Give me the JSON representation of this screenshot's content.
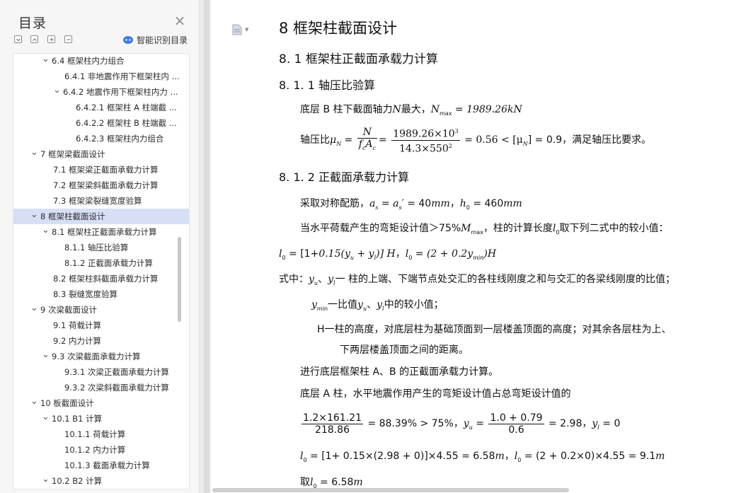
{
  "sidebar": {
    "title": "目录",
    "close_icon": "close-icon",
    "tool_buttons": [
      "collapse-all-icon",
      "expand-one-icon",
      "add-icon",
      "remove-icon"
    ],
    "smart_toc_label": "智能识别目录",
    "items": [
      {
        "label": "6.4  框架柱内力组合",
        "level": 1,
        "expanded": true
      },
      {
        "label": "6.4.1  非地震作用下框架柱内 ...",
        "level": 2
      },
      {
        "label": "6.4.2  地震作用下框架柱内力 ...",
        "level": 2,
        "expanded": true
      },
      {
        "label": "6.4.2.1  框架柱 A 柱端截 ...",
        "level": 3
      },
      {
        "label": "6.4.2.2  框架柱 B 柱端截 ...",
        "level": 3
      },
      {
        "label": "6.4.2.3  框架柱内力组合",
        "level": 3
      },
      {
        "label": "7  框架梁截面设计",
        "level": 0,
        "expanded": true
      },
      {
        "label": "7.1  框架梁正截面承载力计算",
        "level": 1
      },
      {
        "label": "7.2  框架梁斜截面承载力计算",
        "level": 1
      },
      {
        "label": "7.3  框架梁裂缝宽度验算",
        "level": 1
      },
      {
        "label": "8  框架柱截面设计",
        "level": 0,
        "expanded": true,
        "selected": true
      },
      {
        "label": "8.1  框架柱正截面承载力计算",
        "level": 1,
        "expanded": true
      },
      {
        "label": "8.1.1  轴压比验算",
        "level": 2
      },
      {
        "label": "8.1.2  正截面承载力计算",
        "level": 2
      },
      {
        "label": "8.2  框架柱斜截面承载力计算",
        "level": 1
      },
      {
        "label": "8.3  裂缝宽度验算",
        "level": 1
      },
      {
        "label": "9  次梁截面设计",
        "level": 0,
        "expanded": true
      },
      {
        "label": "9.1  荷载计算",
        "level": 1
      },
      {
        "label": "9.2  内力计算",
        "level": 1
      },
      {
        "label": "9.3  次梁截面承载力计算",
        "level": 1,
        "expanded": true
      },
      {
        "label": "9.3.1  次梁正截面承载力计算",
        "level": 2
      },
      {
        "label": "9.3.2  次梁斜截面承载力计算",
        "level": 2
      },
      {
        "label": "10  板截面设计",
        "level": 0,
        "expanded": true
      },
      {
        "label": "10.1  B1 计算",
        "level": 1,
        "expanded": true
      },
      {
        "label": "10.1.1  荷载计算",
        "level": 2
      },
      {
        "label": "10.1.2  内力计算",
        "level": 2
      },
      {
        "label": "10.1.3  截面承载力计算",
        "level": 2
      },
      {
        "label": "10.2  B2 计算",
        "level": 1,
        "expanded": true
      }
    ]
  },
  "doc": {
    "h1": "8  框架柱截面设计",
    "h2": "8. 1  框架柱正截面承载力计算",
    "h3a": "8. 1. 1  轴压比验算",
    "p1_pre": "底层 B 柱下截面轴力",
    "p1_N": "N",
    "p1_mid": "最大，",
    "p1_Nmax": "N",
    "p1_max_sub": "max",
    "p1_val": " = 1989.26",
    "p1_unit": "kN",
    "p2_pre": "轴压比",
    "p2_mu": "μ",
    "p2_N_sub": "N",
    "p2_eq": " = ",
    "p2_frac1_num": "N",
    "p2_frac1_den": "f",
    "p2_frac1_den_sub": "c",
    "p2_frac1_den2": "A",
    "p2_frac1_den2_sub": "c",
    "p2_frac2_num": "1989.26×10",
    "p2_frac2_num_sup": "3",
    "p2_frac2_den": "14.3×550",
    "p2_frac2_den_sup": "2",
    "p2_tail": " = 0.56 < [μ",
    "p2_tail_sub": "N",
    "p2_tail2": "] = 0.9",
    "p2_comment": "，满足轴压比要求。",
    "h3b": "8. 1. 2  正截面承载力计算",
    "p3": "采取对称配筋，",
    "p3_m": "a",
    "p3_s1": "s",
    "p3_eq1": " = a",
    "p3_s2": "s",
    "p3_prime": "′",
    "p3_val1": " = 40",
    "p3_unit1": "mm",
    "p3_comma": "，",
    "p3_h": "h",
    "p3_h_sub": "0",
    "p3_val2": " = 460",
    "p3_unit2": "mm",
    "p4_pre": "当水平荷载产生的弯矩设计值＞75%",
    "p4_M": "M",
    "p4_M_sub": "max",
    "p4_mid": "，柱的计算长度",
    "p4_l": "l",
    "p4_l_sub": "0",
    "p4_post": "取下列二式中的较小值：",
    "f1_l": "l",
    "f1_sub": "0",
    "f1_eq": " = ",
    "f1_overlap": "[1+",
    "f1_body": "0.15(y",
    "f1_yu_sub": "u",
    "f1_plus": " + y",
    "f1_yl_sub": "l",
    "f1_close": ")] H",
    "f1_sep": "，",
    "f2_l": "l",
    "f2_sub": "0",
    "f2_body": " = (2 + 0.2y",
    "f2_min": "min",
    "f2_close": ")H",
    "p5_pre": "式中：",
    "p5_yu": "y",
    "p5_yu_sub": "u",
    "p5_sep": "、",
    "p5_yl": "y",
    "p5_yl_sub": "l",
    "p5_text": "一  柱的上端、下端节点处交汇的各柱线刚度之和与交汇的各梁线刚度的比值；",
    "p6_y": "y",
    "p6_min": "min",
    "p6_text1": "一比值",
    "p6_yu": "y",
    "p6_yu_sub": "u",
    "p6_sep": "、",
    "p6_yl": "y",
    "p6_yl_sub": "l",
    "p6_text2": "中的较小值；",
    "p7": "H一柱的高度，对底层柱为基础顶面到一层楼盖顶面的高度；对其余各层柱为上、",
    "p8": "下两层楼盖顶面之间的距离。",
    "p9": "进行底层框架柱 A、B 的正截面承载力计算。",
    "p10": "底层 A 柱，水平地震作用产生的弯矩设计值占总弯矩设计值的",
    "f3_num": "1.2×161.21",
    "f3_den": "218.86",
    "f3_tail": " = 88.39% > 75%",
    "f3_sep": "，",
    "f3_yu": "y",
    "f3_yu_sub": "u",
    "f3_eq": " = ",
    "f3_num2": "1.0 + 0.79",
    "f3_den2": "0.6",
    "f3_tail2": " = 2.98",
    "f3_sep2": "，",
    "f3_yl": "y",
    "f3_yl_sub": "l",
    "f3_tail3": " = 0",
    "f4_l": "l",
    "f4_sub": "0",
    "f4_body": " = [1+ 0.15×(2.98 + 0)]×4.55 = 6.58",
    "f4_unit": "m",
    "f4_sep": "，",
    "f4_l2": "l",
    "f4_sub2": "0",
    "f4_body2": " = (2 + 0.2×0)×4.55 = 9.1",
    "f4_unit2": "m",
    "p11_pre": "取",
    "p11_l": "l",
    "p11_sub": "0",
    "p11_val": " = 6.58",
    "p11_unit": "m"
  }
}
